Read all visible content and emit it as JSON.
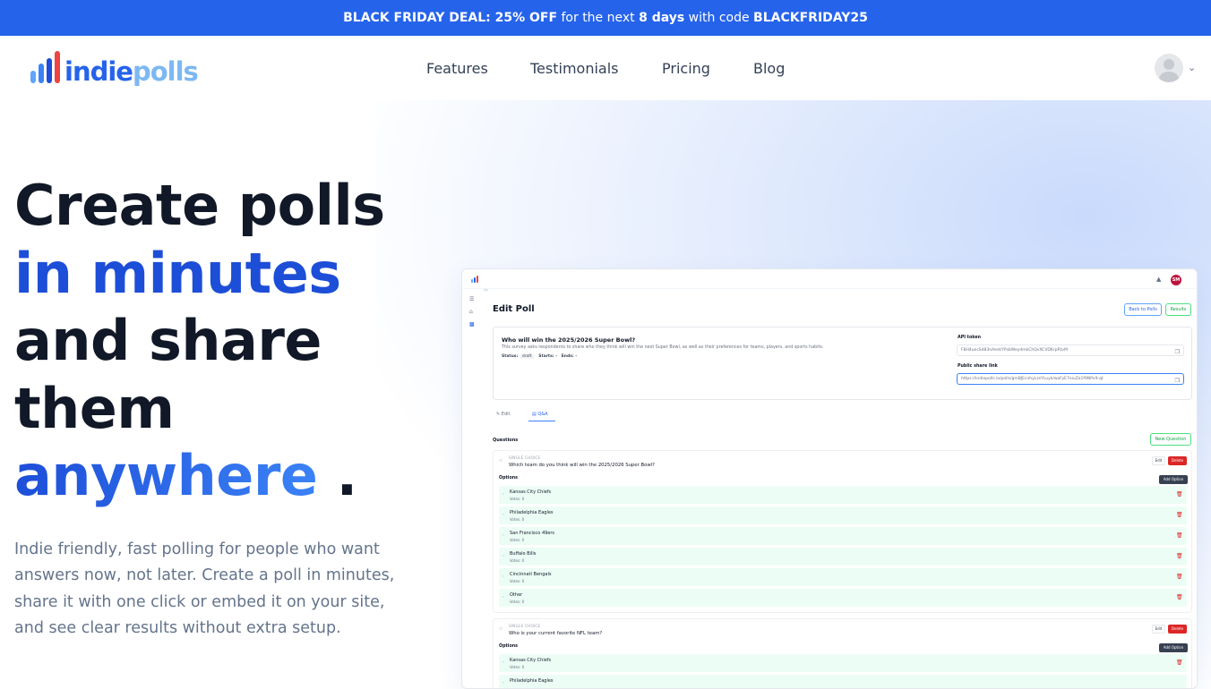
{
  "banner": {
    "deal_label": "BLACK FRIDAY DEAL: 25% OFF",
    "text_mid": " for the next ",
    "days": "8 days",
    "text_code": " with code ",
    "code": "BLACKFRIDAY25"
  },
  "brand": {
    "name_part1": "indie",
    "name_part2": "polls"
  },
  "nav": {
    "features": "Features",
    "testimonials": "Testimonials",
    "pricing": "Pricing",
    "blog": "Blog"
  },
  "hero": {
    "line1": "Create polls",
    "line2": "in minutes",
    "line3": "and share",
    "line4": "them",
    "line5": "anywhere",
    "line5_end": " .",
    "subtitle": "Indie friendly, fast polling for people who want answers now, not later. Create a poll in minutes, share it with one click or embed it on your site, and see clear results without extra setup."
  },
  "app": {
    "avatar_initials": "SM",
    "page_title": "Edit Poll",
    "back_button": "Back to Polls",
    "results_button": "Results",
    "poll": {
      "question": "Who will win the 2025/2026 Super Bowl?",
      "description": "This survey asks respondents to share who they think will win the next Super Bowl, as well as their preferences for teams, players, and sports habits.",
      "status_label": "Status:",
      "status_value": "draft",
      "starts_label": "Starts: -",
      "ends_label": "Ends: -",
      "api_token_label": "API token",
      "api_token_value": "F8H4uecSd83nAedcYPsbWeydmkChQvXCVDKrpRtvM",
      "share_label": "Public share link",
      "share_value": "https://indiepolls.io/polls/gmBJEcnhyLzsYLuyk/waFyE7eiuZa1f9NPx9-qt"
    },
    "tabs": {
      "edit": "Edit",
      "qa": "Q&A"
    },
    "questions_label": "Questions",
    "new_question": "New Question",
    "edit_btn": "Edit",
    "delete_btn": "Delete",
    "options_label": "Options",
    "add_option": "Add Option",
    "questions": [
      {
        "type": "SINGLE CHOICE",
        "text": "Which team do you think will win the 2025/2026 Super Bowl?",
        "options": [
          {
            "name": "Kansas City Chiefs",
            "votes": "Votes: 0"
          },
          {
            "name": "Philadelphia Eagles",
            "votes": "Votes: 0"
          },
          {
            "name": "San Francisco 49ers",
            "votes": "Votes: 0"
          },
          {
            "name": "Buffalo Bills",
            "votes": "Votes: 0"
          },
          {
            "name": "Cincinnati Bengals",
            "votes": "Votes: 0"
          },
          {
            "name": "Other",
            "votes": "Votes: 0"
          }
        ]
      },
      {
        "type": "SINGLE CHOICE",
        "text": "Who is your current favorite NFL team?",
        "options": [
          {
            "name": "Kansas City Chiefs",
            "votes": "Votes: 0"
          },
          {
            "name": "Philadelphia Eagles",
            "votes": ""
          }
        ]
      }
    ]
  },
  "colors": {
    "primary": "#2563eb",
    "banner": "#2563eb",
    "heading": "#111827",
    "danger": "#dc2626",
    "success": "#16a34a"
  }
}
